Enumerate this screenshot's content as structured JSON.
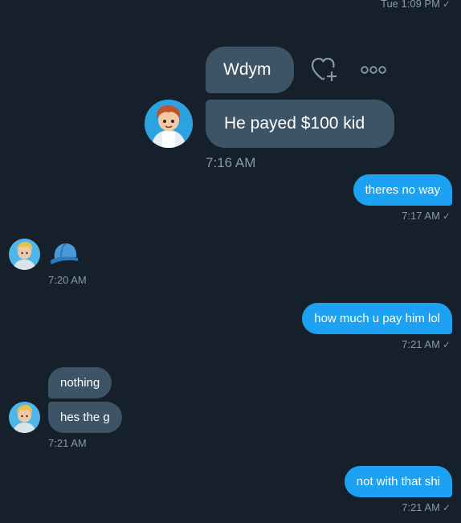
{
  "top_meta": {
    "text": "Tue 1:09 PM",
    "check": "✓"
  },
  "zoomed": {
    "msg1": "Wdym",
    "msg2": "He payed $100 kid",
    "time": "7:16 AM"
  },
  "messages": [
    {
      "text": "theres no way",
      "meta": "7:17 AM",
      "check": "✓"
    },
    {
      "meta": "7:20 AM"
    },
    {
      "text": "how much u pay him lol",
      "meta": "7:21 AM",
      "check": "✓"
    },
    {
      "text": "nothing"
    },
    {
      "text": "hes the g",
      "meta": "7:21 AM"
    },
    {
      "text": "not with that shi",
      "meta": "7:21 AM",
      "check": "✓"
    }
  ],
  "colors": {
    "background": "#15202b",
    "outgoing": "#1da1f2",
    "incoming": "#3d5466",
    "meta": "#8899a6"
  },
  "icons": [
    "heart-plus-icon",
    "more-icon",
    "cap-emoji"
  ]
}
